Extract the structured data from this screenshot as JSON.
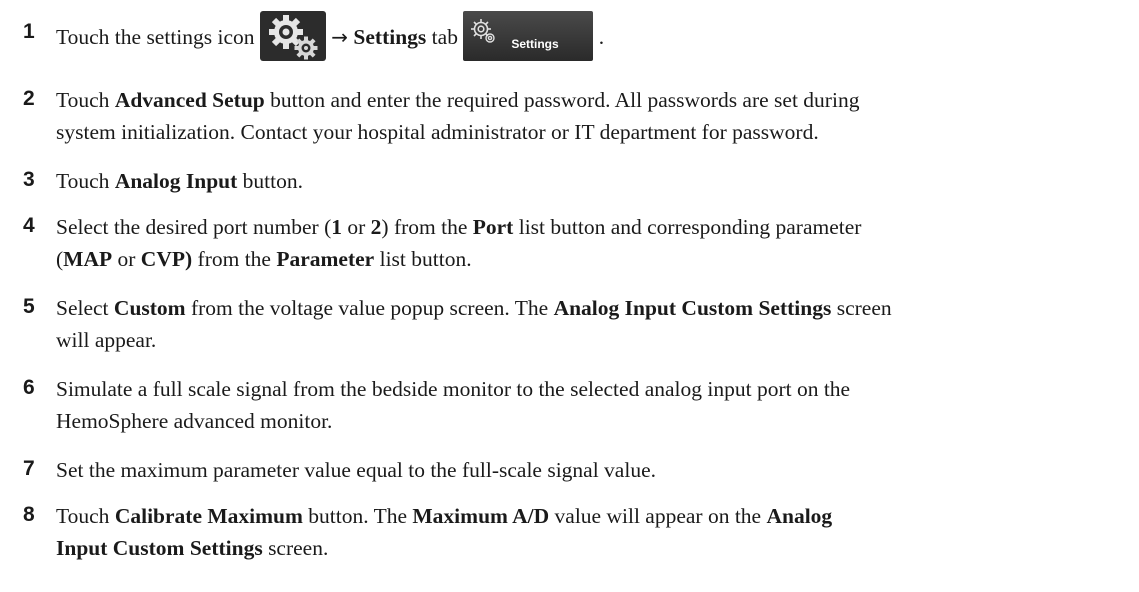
{
  "steps": [
    {
      "number": "1",
      "parts": {
        "a": "Touch the settings icon",
        "arrow": "→",
        "b": "Settings",
        "c": "tab",
        "tab_label": "Settings",
        "end": "."
      }
    },
    {
      "number": "2",
      "line1": {
        "a": "Touch ",
        "b": "Advanced Setup",
        "c": " button and enter the required password. All passwords are set during"
      },
      "line2": "system initialization. Contact your hospital administrator or IT department for password."
    },
    {
      "number": "3",
      "line1": {
        "a": "Touch ",
        "b": "Analog Input",
        "c": " button."
      }
    },
    {
      "number": "4",
      "line1": {
        "a": "Select the desired port number (",
        "b": "1",
        "c": " or ",
        "d": "2",
        "e": ") from the ",
        "f": "Port",
        "g": " list button and corresponding parameter"
      },
      "line2": {
        "a": "(",
        "b": "MAP",
        "c": " or ",
        "d": "CVP)",
        "e": " from the ",
        "f": "Parameter",
        "g": " list button."
      }
    },
    {
      "number": "5",
      "line1": {
        "a": "Select ",
        "b": "Custom",
        "c": " from the voltage value popup screen. The ",
        "d": "Analog Input Custom Settings",
        "e": " screen"
      },
      "line2": "will appear."
    },
    {
      "number": "6",
      "line1": "Simulate a full scale signal from the bedside monitor to the selected analog input port on the",
      "line2": "HemoSphere advanced monitor."
    },
    {
      "number": "7",
      "line1": "Set the maximum parameter value equal to the full-scale signal value."
    },
    {
      "number": "8",
      "line1": {
        "a": "Touch ",
        "b": "Calibrate Maximum",
        "c": " button. The ",
        "d": "Maximum A/D",
        "e": " value will appear on the ",
        "f": "Analog"
      },
      "line2": {
        "a": "Input Custom Settings",
        "b": " screen."
      }
    }
  ],
  "icons": {
    "settings_icon": "gear-pair-icon",
    "settings_tab_icon": "gear-outline-icon"
  },
  "colors": {
    "icon_background": "#2c2c2c",
    "icon_gear_fill": "#e8e8e8",
    "tab_background": "#3a3a3a",
    "tab_text": "#ffffff"
  }
}
